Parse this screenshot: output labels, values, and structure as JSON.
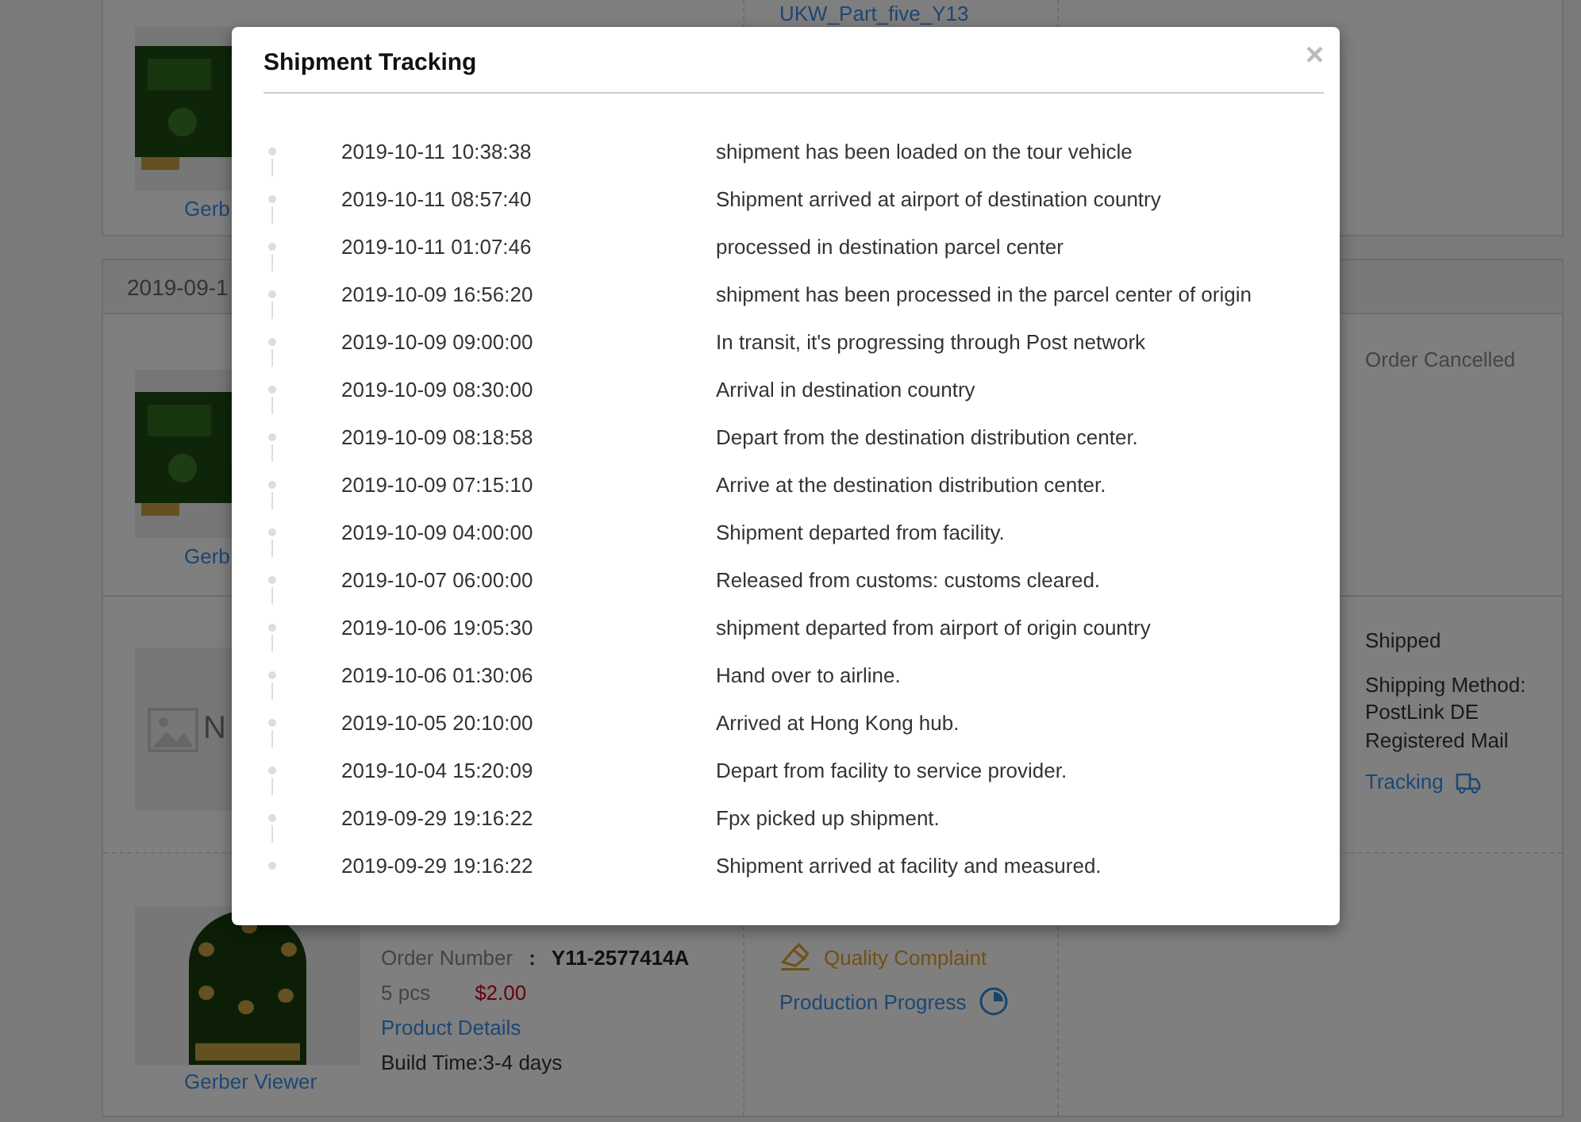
{
  "order_list": {
    "top_item": {
      "gerber_link": "Gerb",
      "file_link": "UKW_Part_five_Y13"
    },
    "order_group": {
      "date": "2019-09-1",
      "items": [
        {
          "kind": "cancelled",
          "gerber_link": "Gerb",
          "status": "Order Cancelled"
        },
        {
          "kind": "shipped",
          "image_text": "N",
          "status": "Shipped",
          "shipping_method_label": "Shipping Method:",
          "shipping_method_lines": [
            "PostLink DE",
            "Registered Mail"
          ],
          "tracking_link": "Tracking"
        },
        {
          "kind": "product",
          "gerber_link": "Gerber Viewer",
          "order_number_label": "Order Number",
          "order_number_separator": ":",
          "order_number": "Y11-2577414A",
          "quantity": "5 pcs",
          "price": "$2.00",
          "details_link": "Product Details",
          "build_time": "Build Time:3-4 days",
          "quality_complaint": "Quality Complaint",
          "progress_link": "Production Progress"
        }
      ]
    }
  },
  "modal": {
    "title": "Shipment Tracking",
    "close": "×",
    "events": [
      {
        "time": "2019-10-11 10:38:38",
        "description": "shipment has been loaded on the tour vehicle"
      },
      {
        "time": "2019-10-11 08:57:40",
        "description": "Shipment arrived at airport of destination country"
      },
      {
        "time": "2019-10-11 01:07:46",
        "description": "processed in destination parcel center"
      },
      {
        "time": "2019-10-09 16:56:20",
        "description": "shipment has been processed in the parcel center of origin"
      },
      {
        "time": "2019-10-09 09:00:00",
        "description": "In transit, it's progressing through Post network"
      },
      {
        "time": "2019-10-09 08:30:00",
        "description": "Arrival in destination country"
      },
      {
        "time": "2019-10-09 08:18:58",
        "description": "Depart from the destination distribution center."
      },
      {
        "time": "2019-10-09 07:15:10",
        "description": "Arrive at the destination distribution center."
      },
      {
        "time": "2019-10-09 04:00:00",
        "description": "Shipment departed from facility."
      },
      {
        "time": "2019-10-07 06:00:00",
        "description": "Released from customs: customs cleared."
      },
      {
        "time": "2019-10-06 19:05:30",
        "description": "shipment departed from airport of origin country"
      },
      {
        "time": "2019-10-06 01:30:06",
        "description": "Hand over to airline."
      },
      {
        "time": "2019-10-05 20:10:00",
        "description": "Arrived at Hong Kong hub."
      },
      {
        "time": "2019-10-04 15:20:09",
        "description": "Depart from facility to service provider."
      },
      {
        "time": "2019-09-29 19:16:22",
        "description": "Fpx picked up shipment."
      },
      {
        "time": "2019-09-29 19:16:22",
        "description": "Shipment arrived at facility and measured."
      }
    ]
  }
}
